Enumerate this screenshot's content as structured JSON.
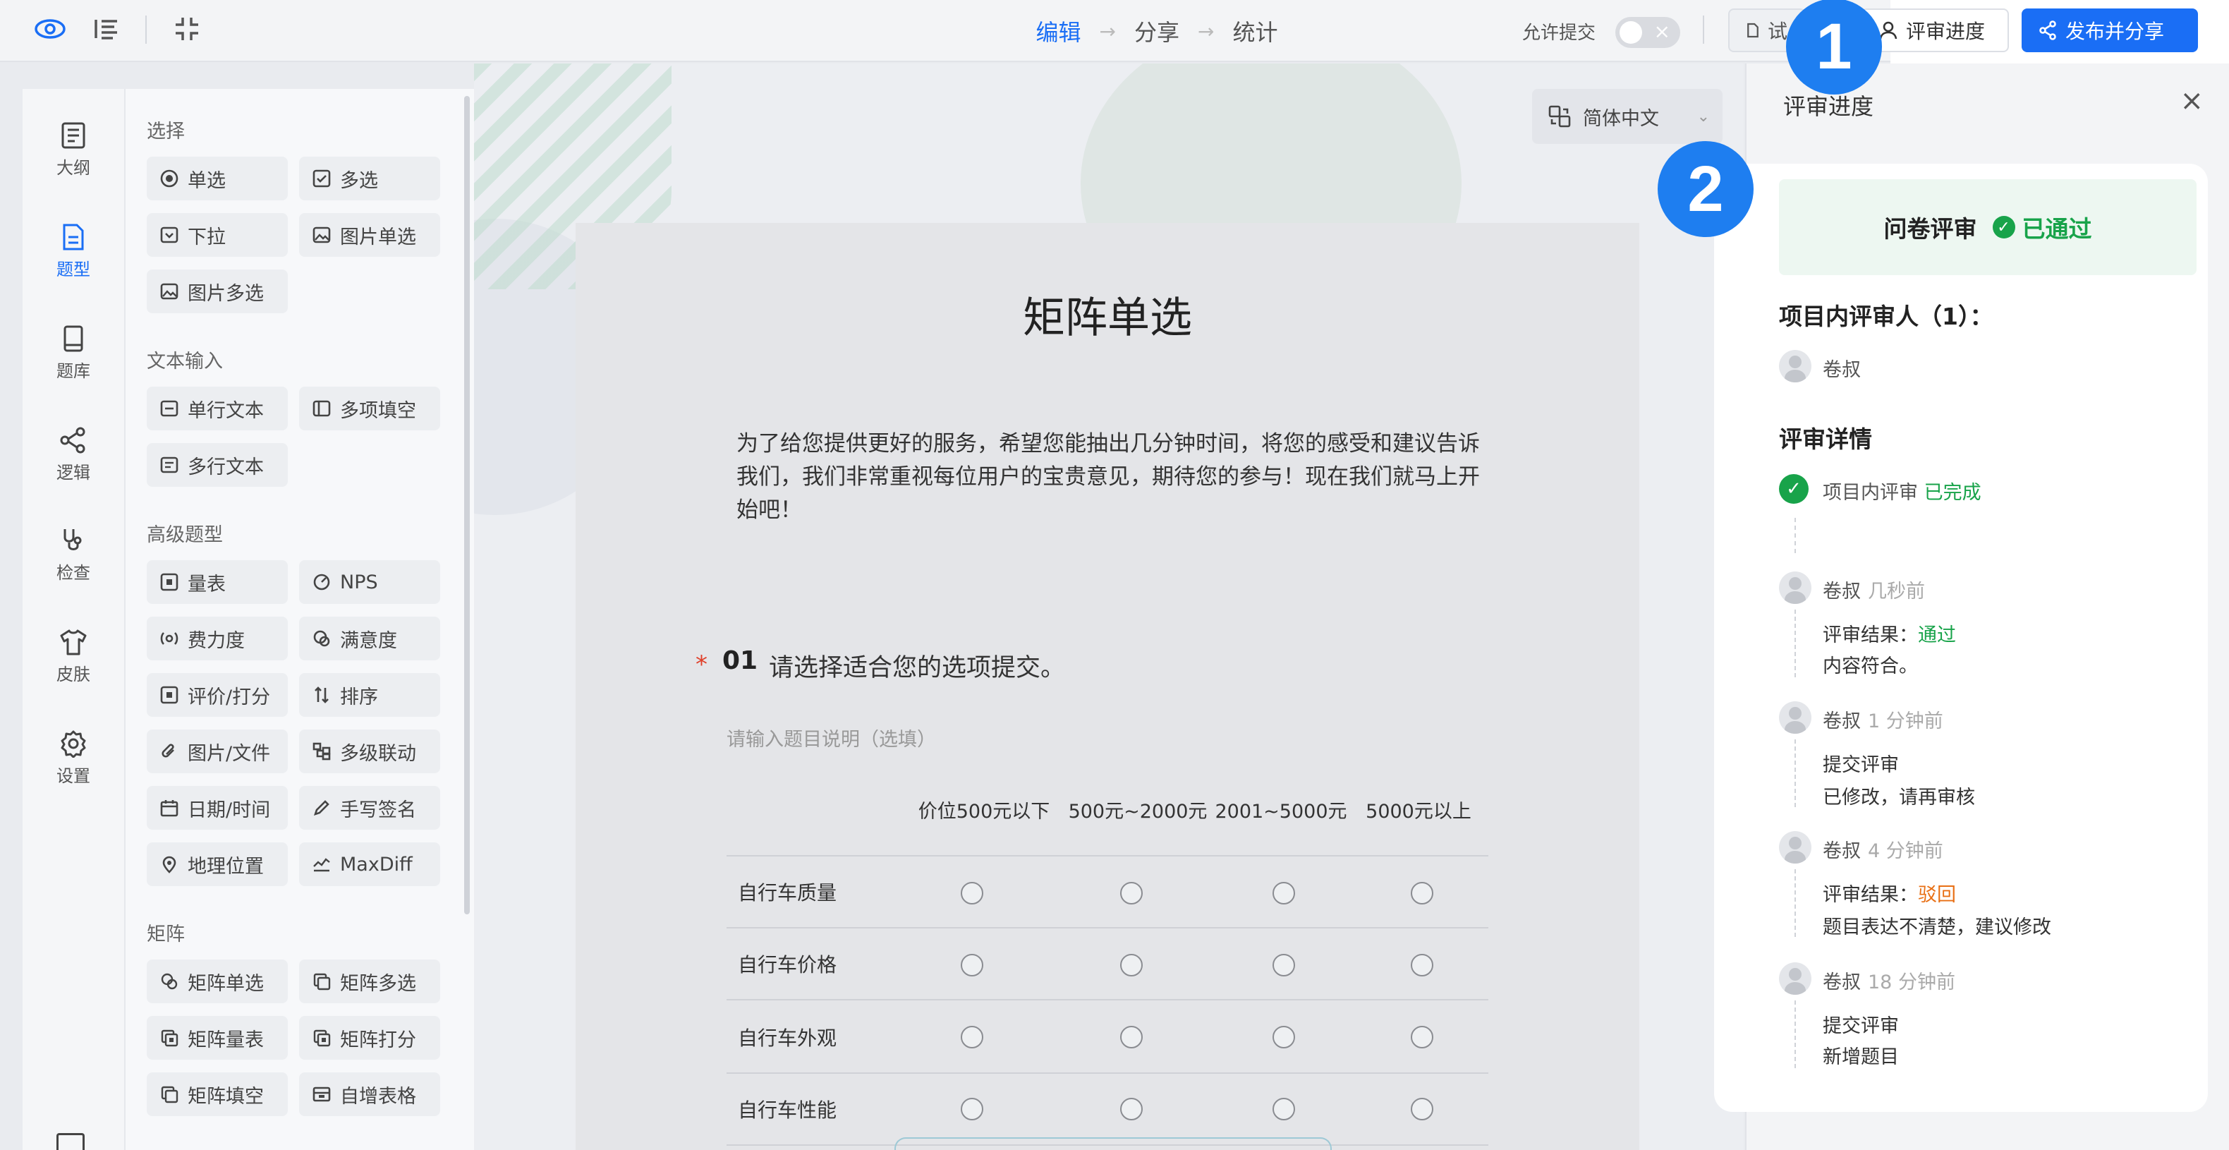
{
  "topbar": {
    "steps": [
      "编辑",
      "分享",
      "统计"
    ],
    "step_arrows": [
      "→",
      "→"
    ],
    "allow_submit_label": "允许提交",
    "preview_button": "试",
    "review_button": "评审进度",
    "publish_button": "发布并分享",
    "accent_color": "#1a6ef5"
  },
  "rail": {
    "items": [
      {
        "label": "大纲",
        "icon": "outline-icon"
      },
      {
        "label": "题型",
        "icon": "question-type-icon"
      },
      {
        "label": "题库",
        "icon": "question-bank-icon"
      },
      {
        "label": "逻辑",
        "icon": "logic-icon"
      },
      {
        "label": "检查",
        "icon": "check-icon"
      },
      {
        "label": "皮肤",
        "icon": "skin-icon"
      },
      {
        "label": "设置",
        "icon": "settings-icon"
      }
    ]
  },
  "types": {
    "groups": [
      {
        "title": "选择",
        "items": [
          "单选",
          "多选",
          "下拉",
          "图片单选",
          "图片多选"
        ]
      },
      {
        "title": "文本输入",
        "items": [
          "单行文本",
          "多项填空",
          "多行文本"
        ]
      },
      {
        "title": "高级题型",
        "items": [
          "量表",
          "NPS",
          "费力度",
          "满意度",
          "评价/打分",
          "排序",
          "图片/文件",
          "多级联动",
          "日期/时间",
          "手写签名",
          "地理位置",
          "MaxDiff"
        ]
      },
      {
        "title": "矩阵",
        "items": [
          "矩阵单选",
          "矩阵多选",
          "矩阵量表",
          "矩阵打分",
          "矩阵填空",
          "自增表格"
        ]
      }
    ]
  },
  "language": {
    "selected": "简体中文"
  },
  "survey": {
    "title": "矩阵单选",
    "description": "为了给您提供更好的服务，希望您能抽出几分钟时间，将您的感受和建议告诉我们，我们非常重视每位用户的宝贵意见，期待您的参与！现在我们就马上开始吧！",
    "question": {
      "required_mark": "*",
      "number": "01",
      "text": "请选择适合您的选项提交。",
      "subtitle_placeholder": "请输入题目说明（选填）",
      "columns": [
        "价位500元以下",
        "500元~2000元",
        "2001~5000元",
        "5000元以上"
      ],
      "rows": [
        "自行车质量",
        "自行车价格",
        "自行车外观",
        "自行车性能"
      ]
    }
  },
  "review_panel": {
    "title": "评审进度",
    "close": "×",
    "status_title": "问卷评审",
    "status_value": "已通过",
    "reviewers_title": "项目内评审人（1）：",
    "reviewer_name": "卷叔",
    "details_title": "评审详情",
    "timeline": {
      "done_label": "项目内评审",
      "done_status": "已完成",
      "entries": [
        {
          "name": "卷叔",
          "time": "几秒前",
          "line1_label": "评审结果：",
          "line1_value": "通过",
          "line2": "内容符合。"
        },
        {
          "name": "卷叔",
          "time": "1 分钟前",
          "line1_label": "提交评审",
          "line1_value": "",
          "line2": "已修改，请再审核"
        },
        {
          "name": "卷叔",
          "time": "4 分钟前",
          "line1_label": "评审结果：",
          "line1_value": "驳回",
          "line2": "题目表达不清楚，建议修改"
        },
        {
          "name": "卷叔",
          "time": "18 分钟前",
          "line1_label": "提交评审",
          "line1_value": "",
          "line2": "新增题目"
        }
      ]
    }
  },
  "annotations": [
    "1",
    "2"
  ]
}
